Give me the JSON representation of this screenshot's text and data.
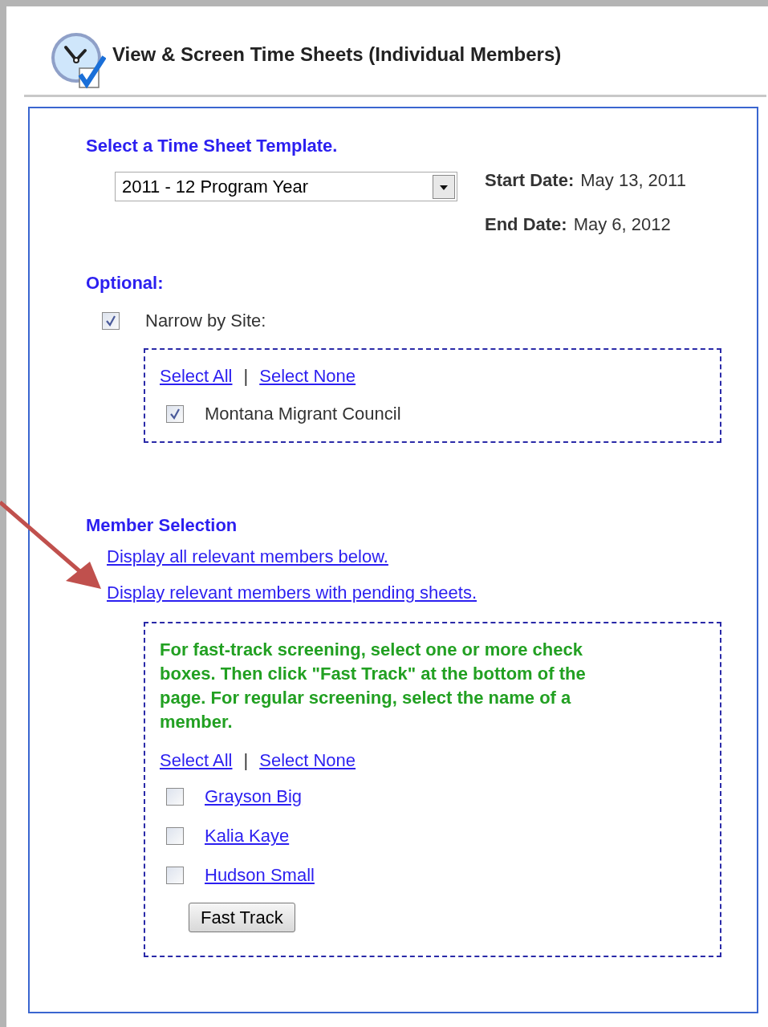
{
  "header": {
    "title": "View & Screen Time Sheets (Individual Members)"
  },
  "template": {
    "label": "Select a Time Sheet Template.",
    "select": {
      "value": "2011 - 12 Program Year"
    },
    "start_date": {
      "label": "Start Date:",
      "value": "May 13, 2011"
    },
    "end_date": {
      "label": "End Date:",
      "value": "May 6, 2012"
    }
  },
  "optional": {
    "heading": "Optional:",
    "narrow": {
      "label": "Narrow by Site:",
      "checked": true
    },
    "select_all": "Select All",
    "separator": "|",
    "select_none": "Select None",
    "sites": [
      {
        "name": "Montana Migrant Council",
        "checked": true
      }
    ]
  },
  "member_selection": {
    "heading": "Member Selection",
    "links": [
      "Display all relevant members below.",
      "Display relevant members with pending sheets."
    ],
    "instructions": "For fast-track screening, select one or more check boxes. Then click \"Fast Track\" at the bottom of the page. For regular screening, select the name of a member.",
    "select_all": "Select All",
    "separator": "|",
    "select_none": "Select None",
    "members": [
      {
        "name": "Grayson Big",
        "checked": false
      },
      {
        "name": "Kalia Kaye",
        "checked": false
      },
      {
        "name": "Hudson Small",
        "checked": false
      }
    ],
    "button": "Fast Track"
  }
}
